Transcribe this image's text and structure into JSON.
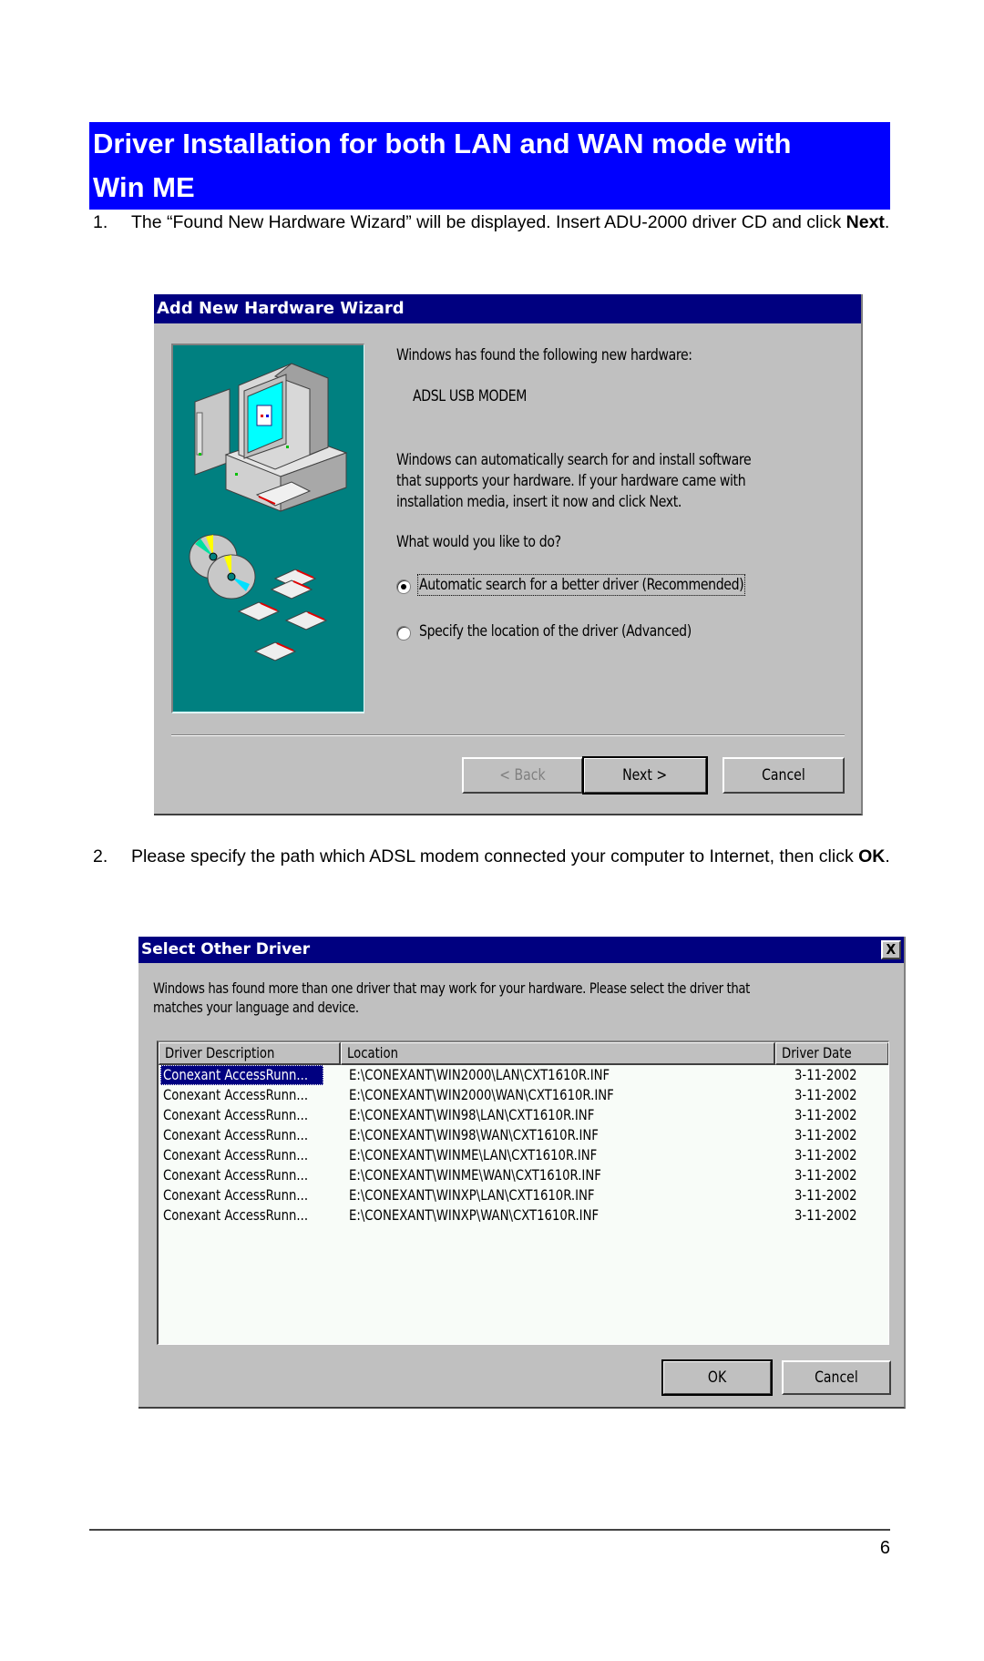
{
  "heading": {
    "line1": "Driver Installation for both LAN and WAN mode with",
    "line2": "Win ME",
    "color": "#0000ff"
  },
  "steps": [
    {
      "number": "1.",
      "text_before": "The “Found New Hardware Wizard” will be displayed. Insert ADU-2000 driver CD and click ",
      "bold": "Next",
      "text_after": "."
    },
    {
      "number": "2.",
      "text_before": "Please specify the path which ADSL modem connected your computer to Internet, then click ",
      "bold": "OK",
      "text_after": "."
    }
  ],
  "wizard": {
    "title": "Add New Hardware Wizard",
    "found_label": "Windows has found the following new hardware:",
    "device_name": "ADSL USB MODEM",
    "description_lines": [
      "Windows can automatically search for and install software",
      "that supports your hardware. If your hardware came with",
      "installation media, insert it now and click Next."
    ],
    "question": "What would you like to do?",
    "options": [
      {
        "label": "Automatic search for a better driver (Recommended)",
        "checked": true
      },
      {
        "label": "Specify the location of the driver (Advanced)",
        "checked": false
      }
    ],
    "buttons": {
      "back": "< Back",
      "next": "Next >",
      "cancel": "Cancel"
    },
    "title_color": "#000080",
    "panel_color": "#008080"
  },
  "select_driver": {
    "title": "Select Other Driver",
    "close_label": "X",
    "message_lines": [
      "Windows has found more than one driver that may work for your hardware.  Please select the driver that",
      "matches your language and device."
    ],
    "columns": [
      "Driver Description",
      "Location",
      "Driver Date"
    ],
    "rows": [
      {
        "description": "Conexant AccessRunn...",
        "location": "E:\\CONEXANT\\WIN2000\\LAN\\CXT1610R.INF",
        "date": "3-11-2002",
        "selected": true
      },
      {
        "description": "Conexant AccessRunn...",
        "location": "E:\\CONEXANT\\WIN2000\\WAN\\CXT1610R.INF",
        "date": "3-11-2002",
        "selected": false
      },
      {
        "description": "Conexant AccessRunn...",
        "location": "E:\\CONEXANT\\WIN98\\LAN\\CXT1610R.INF",
        "date": "3-11-2002",
        "selected": false
      },
      {
        "description": "Conexant AccessRunn...",
        "location": "E:\\CONEXANT\\WIN98\\WAN\\CXT1610R.INF",
        "date": "3-11-2002",
        "selected": false
      },
      {
        "description": "Conexant AccessRunn...",
        "location": "E:\\CONEXANT\\WINME\\LAN\\CXT1610R.INF",
        "date": "3-11-2002",
        "selected": false
      },
      {
        "description": "Conexant AccessRunn...",
        "location": "E:\\CONEXANT\\WINME\\WAN\\CXT1610R.INF",
        "date": "3-11-2002",
        "selected": false
      },
      {
        "description": "Conexant AccessRunn...",
        "location": "E:\\CONEXANT\\WINXP\\LAN\\CXT1610R.INF",
        "date": "3-11-2002",
        "selected": false
      },
      {
        "description": "Conexant AccessRunn...",
        "location": "E:\\CONEXANT\\WINXP\\WAN\\CXT1610R.INF",
        "date": "3-11-2002",
        "selected": false
      }
    ],
    "buttons": {
      "ok": "OK",
      "cancel": "Cancel"
    }
  },
  "footer": {
    "page_number": "6"
  }
}
